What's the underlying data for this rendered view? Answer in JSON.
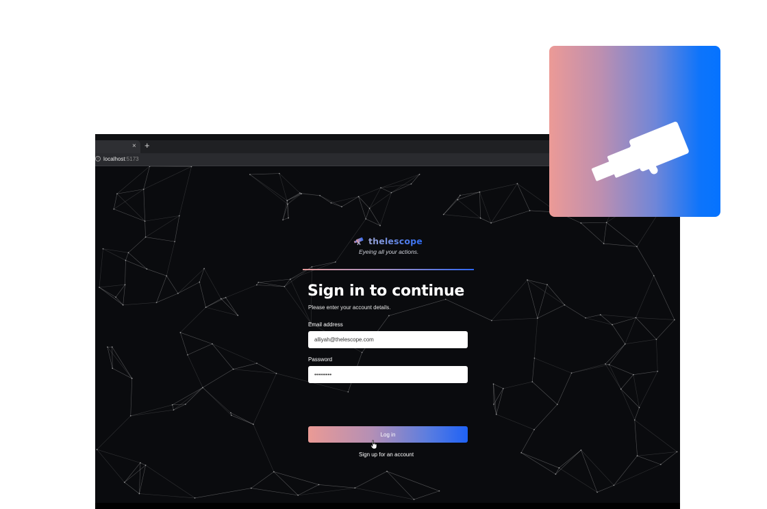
{
  "browser": {
    "tab": {
      "close_glyph": "×",
      "new_tab_glyph": "+"
    },
    "address": {
      "info_glyph": "i",
      "host": "localhost",
      "port": ":5173"
    }
  },
  "app": {
    "brand_name": "thelescope",
    "tagline": "Eyeing all your actions.",
    "title": "Sign in to continue",
    "subtitle": "Please enter your account details.",
    "email_label": "Email address",
    "email_value": "alliyah@thelescope.com",
    "password_label": "Password",
    "password_value": "•••••••••",
    "login_label": "Log in",
    "signup_label": "Sign up for an account"
  },
  "colors": {
    "accent_start": "#ea9a95",
    "accent_end": "#1f62f5",
    "background": "#0a0b0e"
  },
  "icons": {
    "logo": "telescope-icon",
    "cursor": "hand-pointer-icon",
    "info": "info-icon"
  }
}
